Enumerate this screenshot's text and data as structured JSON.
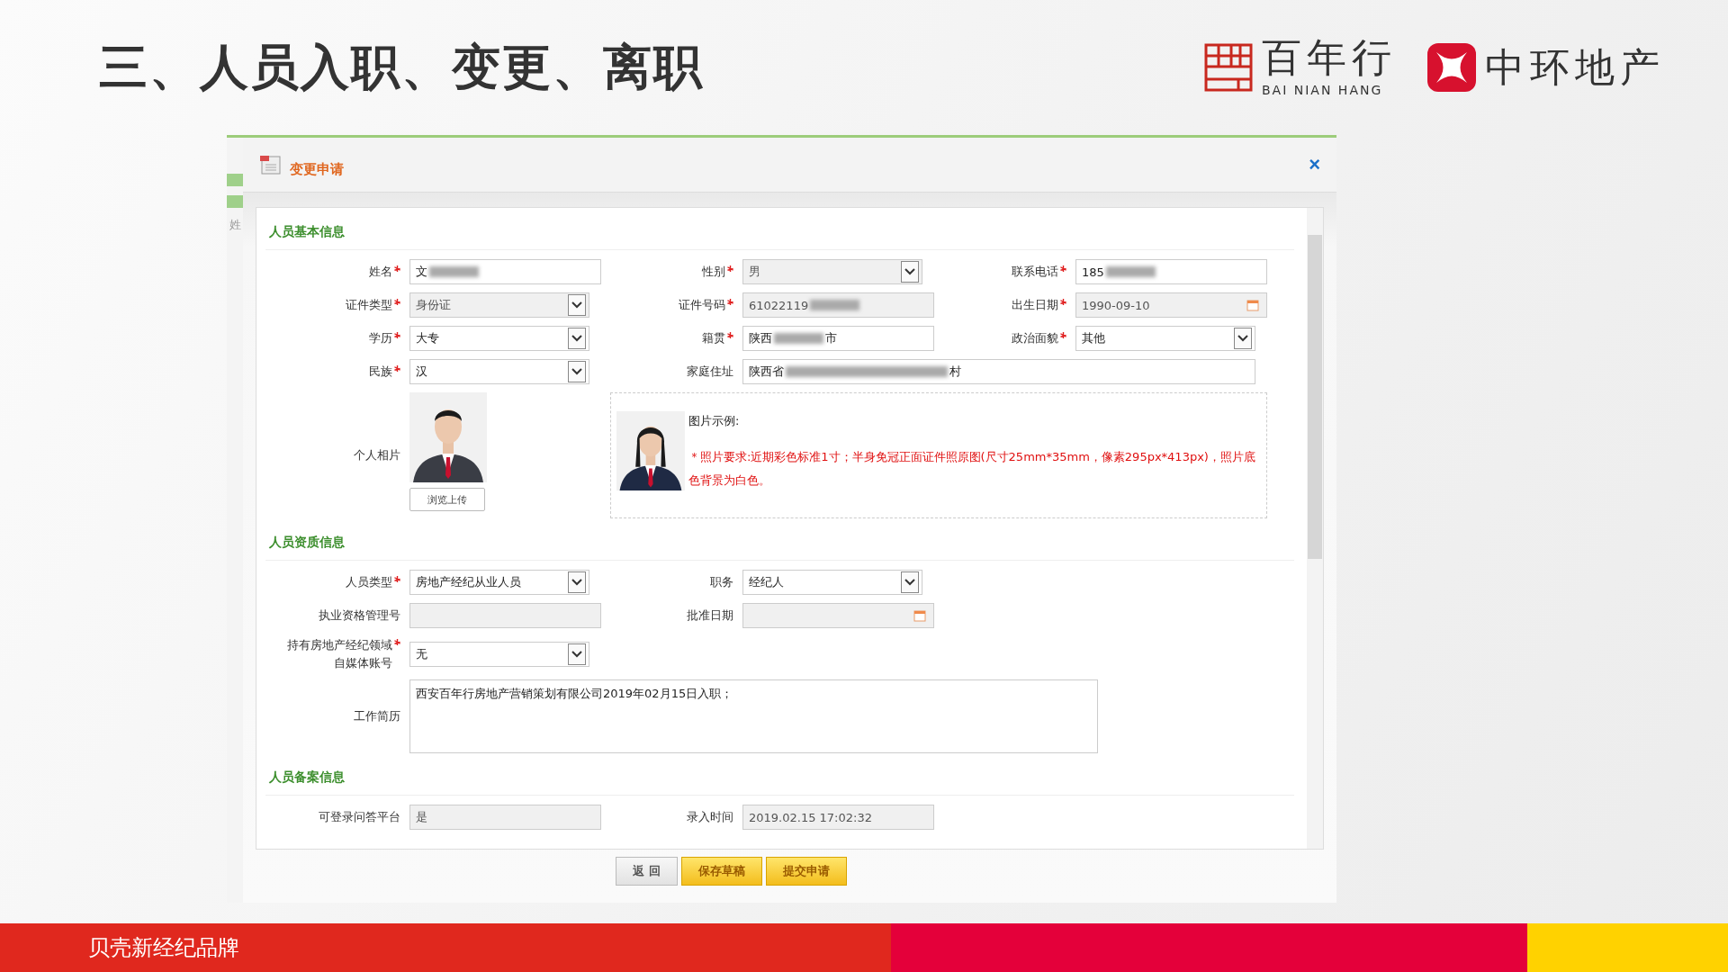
{
  "slide": {
    "title": "三、人员入职、变更、离职",
    "logos": [
      {
        "name": "百年行",
        "subtitle": "BAI NIAN HANG",
        "kind": "grid"
      },
      {
        "name": "中环地产",
        "kind": "cross"
      }
    ],
    "footer": "贝壳新经纪品牌"
  },
  "dialog": {
    "side_text": "姓",
    "title": "变更申请",
    "close": "×",
    "sections": [
      {
        "title": "人员基本信息",
        "fields": [
          {
            "label": "姓名",
            "required": true,
            "kind": "text",
            "disabled": false,
            "value": "文",
            "masked": true
          },
          {
            "label": "性别",
            "required": true,
            "kind": "select",
            "disabled": true,
            "value": "男"
          },
          {
            "label": "联系电话",
            "required": true,
            "kind": "text",
            "disabled": false,
            "value": "185",
            "masked": true
          },
          {
            "label": "证件类型",
            "required": true,
            "kind": "select",
            "disabled": true,
            "value": "身份证"
          },
          {
            "label": "证件号码",
            "required": true,
            "kind": "text",
            "disabled": true,
            "value": "61022119",
            "masked": true
          },
          {
            "label": "出生日期",
            "required": true,
            "kind": "date",
            "disabled": true,
            "value": "1990-09-10"
          },
          {
            "label": "学历",
            "required": true,
            "kind": "select",
            "disabled": false,
            "value": "大专"
          },
          {
            "label": "籍贯",
            "required": true,
            "kind": "text",
            "disabled": false,
            "value": "陕西",
            "masked": true,
            "suffix": "市"
          },
          {
            "label": "政治面貌",
            "required": true,
            "kind": "select",
            "disabled": false,
            "value": "其他"
          },
          {
            "label": "民族",
            "required": true,
            "kind": "select",
            "disabled": false,
            "value": "汉"
          },
          {
            "label": "家庭住址",
            "required": false,
            "kind": "wide",
            "value": "陕西省",
            "masked": true,
            "suffix": "村"
          },
          {
            "label": "个人相片",
            "button": "浏览上传",
            "example_title": "图片示例:",
            "example_note": "＊照片要求:近期彩色标准1寸；半身免冠正面证件照原图(尺寸25mm*35mm，像素295px*413px)，照片底色背景为白色。"
          }
        ]
      },
      {
        "title": "人员资质信息",
        "fields": [
          {
            "label": "人员类型",
            "required": true,
            "kind": "select",
            "disabled": false,
            "value": "房地产经纪从业人员"
          },
          {
            "label": "职务",
            "required": false,
            "kind": "select",
            "disabled": false,
            "value": "经纪人"
          },
          {
            "kind": "blank"
          },
          {
            "label": "执业资格管理号",
            "required": false,
            "kind": "text",
            "disabled": true
          },
          {
            "label": "批准日期",
            "required": false,
            "kind": "date",
            "disabled": true
          },
          {
            "kind": "blank"
          },
          {
            "label": "持有房地产经纪领域自媒体账号",
            "required": true,
            "kind": "select",
            "disabled": false,
            "value": "无"
          },
          {
            "kind": "blank"
          },
          {
            "kind": "blank"
          },
          {
            "label": "工作简历",
            "required": false,
            "kind": "textarea",
            "value": "西安百年行房地产营销策划有限公司2019年02月15日入职；"
          }
        ]
      },
      {
        "title": "人员备案信息",
        "fields": [
          {
            "label": "可登录问答平台",
            "required": false,
            "kind": "text",
            "disabled": true,
            "value": "是"
          },
          {
            "label": "录入时间",
            "required": false,
            "kind": "text",
            "disabled": true,
            "value": "2019.02.15 17:02:32"
          }
        ]
      }
    ],
    "buttons": [
      {
        "label": "返 回",
        "kind": "secondary"
      },
      {
        "label": "保存草稿",
        "kind": "primary"
      },
      {
        "label": "提交申请",
        "kind": "primary"
      }
    ]
  }
}
